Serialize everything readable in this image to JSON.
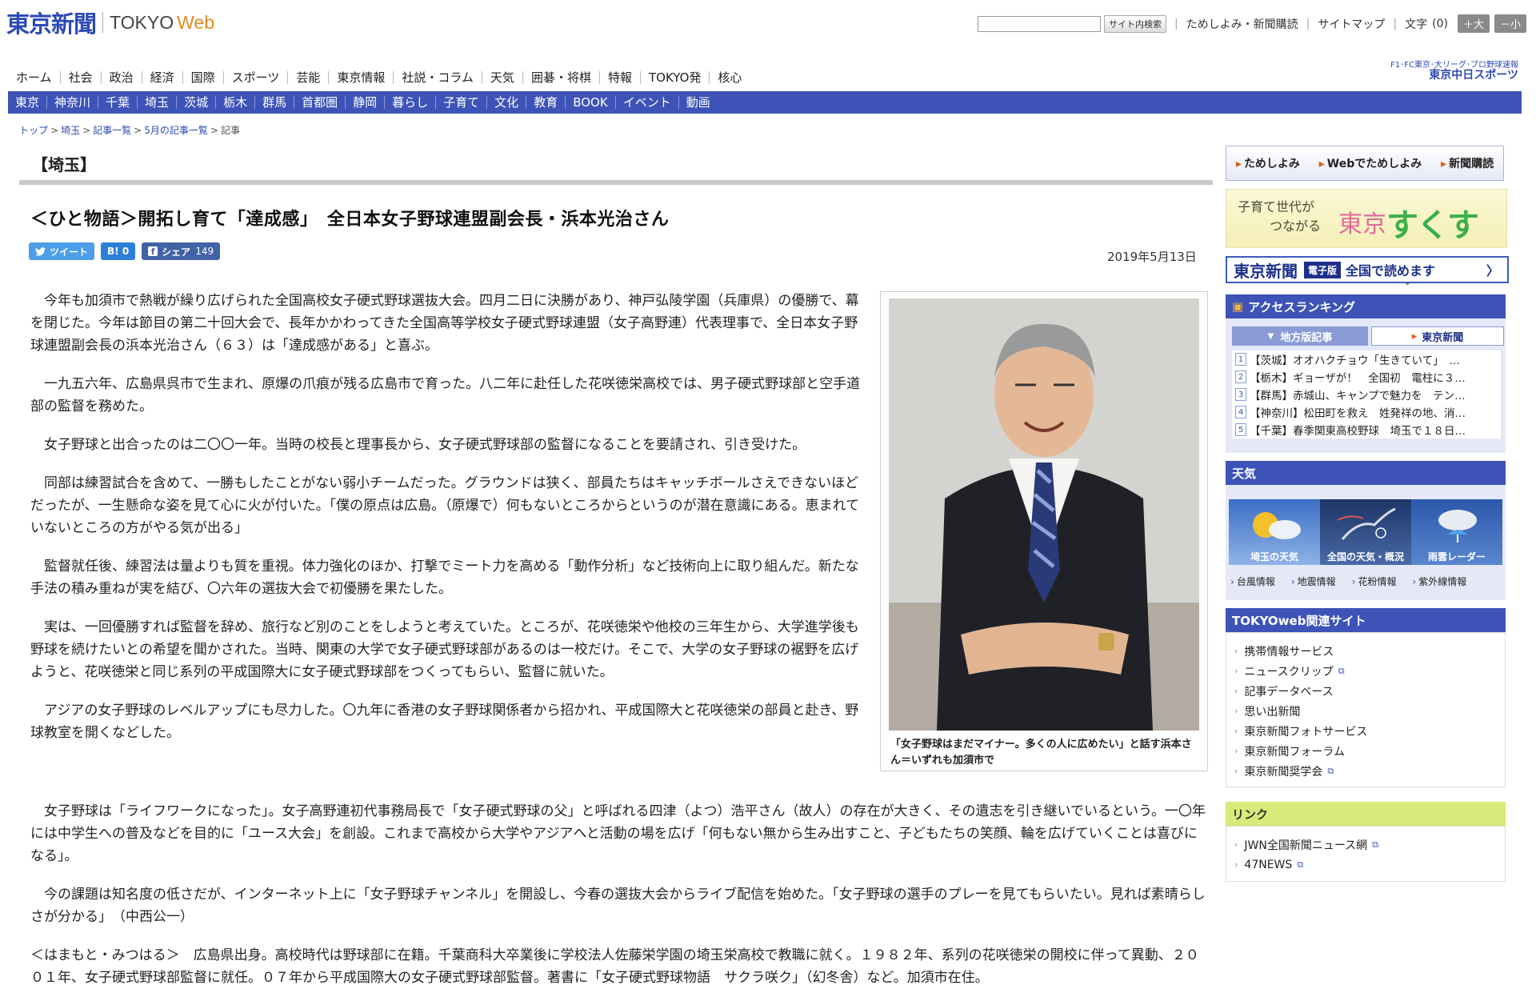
{
  "header": {
    "logo_jp": "東京新聞",
    "logo_tokyo": "TOKYO",
    "logo_web": "Web",
    "search_button": "サイト内検索",
    "links": [
      "ためしよみ・新聞購読",
      "サイトマップ"
    ],
    "font_size_label": "文字",
    "font_size_value": "(0)",
    "size_up": "＋大",
    "size_down": "－小"
  },
  "nav_primary": [
    "ホーム",
    "社会",
    "政治",
    "経済",
    "国際",
    "スポーツ",
    "芸能",
    "東京情報",
    "社説・コラム",
    "天気",
    "囲碁・将棋",
    "特報",
    "TOKYO発",
    "核心"
  ],
  "chunichi": {
    "line1": "F1･FC東京･大リーグ･プロ野球速報",
    "line2": "東京中日スポーツ"
  },
  "nav_regional": [
    "東京",
    "神奈川",
    "千葉",
    "埼玉",
    "茨城",
    "栃木",
    "群馬",
    "首都圏",
    "静岡",
    "暮らし",
    "子育て",
    "文化",
    "教育",
    "BOOK",
    "イベント",
    "動画"
  ],
  "breadcrumb": [
    "トップ",
    "埼玉",
    "記事一覧",
    "5月の記事一覧",
    "記事"
  ],
  "article": {
    "section": "【埼玉】",
    "headline": "＜ひと物語＞開拓し育て「達成感」　全日本女子野球連盟副会長・浜本光治さん",
    "date": "2019年5月13日",
    "social": {
      "tweet": "ツイート",
      "hatena": "B! 0",
      "share": "シェア",
      "share_count": "149"
    },
    "paragraphs": [
      "今年も加須市で熱戦が繰り広げられた全国高校女子硬式野球選抜大会。四月二日に決勝があり、神戸弘陵学園（兵庫県）の優勝で、幕を閉じた。今年は節目の第二十回大会で、長年かかわってきた全国高等学校女子硬式野球連盟（女子高野連）代表理事で、全日本女子野球連盟副会長の浜本光治さん（６３）は「達成感がある」と喜ぶ。",
      "一九五六年、広島県呉市で生まれ、原爆の爪痕が残る広島市で育った。八二年に赴任した花咲徳栄高校では、男子硬式野球部と空手道部の監督を務めた。",
      "女子野球と出合ったのは二〇〇一年。当時の校長と理事長から、女子硬式野球部の監督になることを要請され、引き受けた。",
      "同部は練習試合を含めて、一勝もしたことがない弱小チームだった。グラウンドは狭く、部員たちはキャッチボールさえできないほどだったが、一生懸命な姿を見て心に火が付いた。「僕の原点は広島。（原爆で）何もないところからというのが潜在意識にある。恵まれていないところの方がやる気が出る」",
      "監督就任後、練習法は量よりも質を重視。体力強化のほか、打撃でミート力を高める「動作分析」など技術向上に取り組んだ。新たな手法の積み重ねが実を結び、〇六年の選抜大会で初優勝を果たした。",
      "実は、一回優勝すれば監督を辞め、旅行など別のことをしようと考えていた。ところが、花咲徳栄や他校の三年生から、大学進学後も野球を続けたいとの希望を聞かされた。当時、関東の大学で女子硬式野球部があるのは一校だけ。そこで、大学の女子野球の裾野を広げようと、花咲徳栄と同じ系列の平成国際大に女子硬式野球部をつくってもらい、監督に就いた。",
      "アジアの女子野球のレベルアップにも尽力した。〇九年に香港の女子野球関係者から招かれ、平成国際大と花咲徳栄の部員と赴き、野球教室を開くなどした。"
    ],
    "paragraphs_wide": [
      "女子野球は「ライフワークになった」。女子高野連初代事務局長で「女子硬式野球の父」と呼ばれる四津（よつ）浩平さん（故人）の存在が大きく、その遺志を引き継いでいるという。一〇年には中学生への普及などを目的に「ユース大会」を創設。これまで高校から大学やアジアへと活動の場を広げ「何もない無から生み出すこと、子どもたちの笑顔、輪を広げていくことは喜びになる」。",
      "今の課題は知名度の低さだが、インターネット上に「女子野球チャンネル」を開設し、今春の選抜大会からライブ配信を始めた。「女子野球の選手のプレーを見てもらいたい。見れば素晴らしさが分かる」　（中西公一）"
    ],
    "bio": "＜はまもと・みつはる＞　広島県出身。高校時代は野球部に在籍。千葉商科大卒業後に学校法人佐藤栄学園の埼玉栄高校で教職に就く。１９８２年、系列の花咲徳栄の開校に伴って異動、２００１年、女子硬式野球部監督に就任。０７年から平成国際大の女子硬式野球部監督。著書に「女子硬式野球物語　サクラ咲ク」（幻冬舎）など。加須市在住。",
    "photo_caption": "「女子野球はまだマイナー。多くの人に広めたい」と話す浜本さん＝いずれも加須市で"
  },
  "sidebar": {
    "top_links": [
      "ためしよみ",
      "Webでためしよみ",
      "新聞購読"
    ],
    "sukusuku": {
      "text1": "子育て世代が",
      "text2": "つながる",
      "tokyo": "東京",
      "brand": "すくすく"
    },
    "denshi": {
      "logo": "東京新聞",
      "tag": "電子版",
      "text": "全国で読めます",
      "arrow": "〉"
    },
    "ranking": {
      "title": "アクセスランキング",
      "tab_local": "地方版記事",
      "tab_tokyo": "東京新聞",
      "items": [
        {
          "n": "1",
          "text": "【茨城】オオハクチョウ「生きていて」　…"
        },
        {
          "n": "2",
          "text": "【栃木】ギョーザが！　全国初　電柱に３…"
        },
        {
          "n": "3",
          "text": "【群馬】赤城山、キャンプで魅力を　テン…"
        },
        {
          "n": "4",
          "text": "【神奈川】松田町を救え　姓発祥の地、消…"
        },
        {
          "n": "5",
          "text": "【千葉】春季関東高校野球　埼玉で１８日…"
        }
      ]
    },
    "weather": {
      "title": "天気",
      "cards": [
        "埼玉の天気",
        "全国の天気・概況",
        "雨雲レーダー"
      ],
      "links": [
        "台風情報",
        "地震情報",
        "花粉情報",
        "紫外線情報"
      ]
    },
    "related": {
      "title": "TOKYOweb関連サイト",
      "items": [
        "携帯情報サービス",
        "ニュースクリップ",
        "記事データベース",
        "思い出新聞",
        "東京新聞フォトサービス",
        "東京新聞フォーラム",
        "東京新聞奨学会"
      ]
    },
    "links": {
      "title": "リンク",
      "items": [
        "JWN全国新聞ニュース網",
        "47NEWS"
      ]
    }
  }
}
